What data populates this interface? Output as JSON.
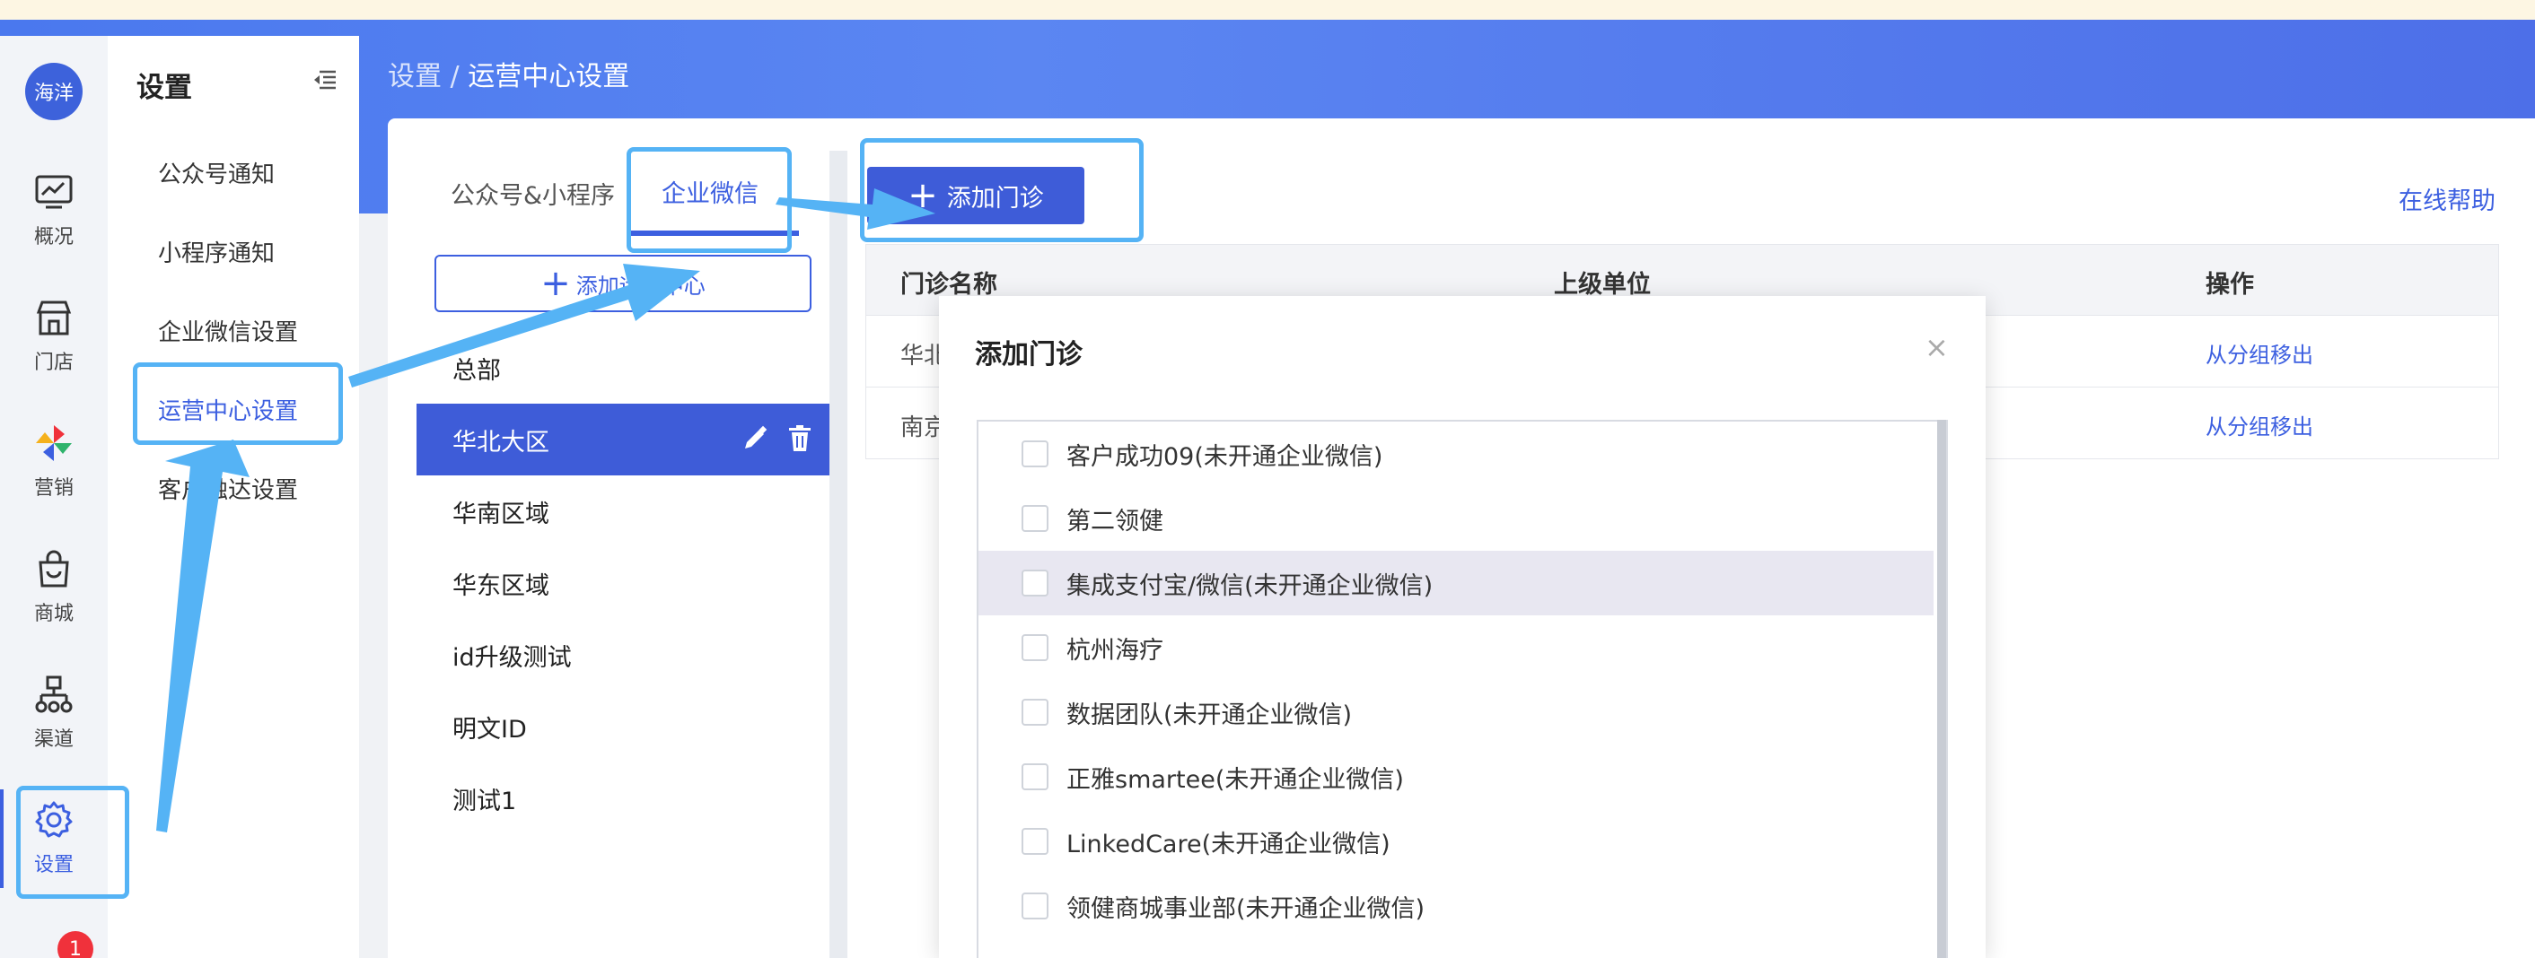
{
  "header": {
    "breadcrumb_parent": "设置 /",
    "breadcrumb_current": "运营中心设置"
  },
  "user": {
    "avatar_text": "海洋"
  },
  "iconnav": {
    "items": [
      {
        "label": "概况",
        "icon": "chart-icon"
      },
      {
        "label": "门店",
        "icon": "store-icon"
      },
      {
        "label": "营销",
        "icon": "pinwheel-icon"
      },
      {
        "label": "商城",
        "icon": "shopping-bag-icon"
      },
      {
        "label": "渠道",
        "icon": "org-tree-icon"
      },
      {
        "label": "设置",
        "icon": "gear-icon"
      }
    ],
    "badge_count": "1"
  },
  "submenu": {
    "title": "设置",
    "items": [
      "公众号通知",
      "小程序通知",
      "企业微信设置",
      "运营中心设置",
      "客户触达设置"
    ]
  },
  "tabs": [
    "公众号&小程序",
    "企业微信"
  ],
  "center_list": {
    "add_button_label": "添加运营中心",
    "items": [
      "总部",
      "华北大区",
      "华南区域",
      "华东区域",
      "id升级测试",
      "明文ID",
      "测试1"
    ],
    "selected": "华北大区"
  },
  "main": {
    "add_clinic_label": "添加门诊",
    "help_link": "在线帮助",
    "table": {
      "columns": [
        "门诊名称",
        "上级单位",
        "操作"
      ],
      "rows": [
        {
          "name": "华北",
          "action": "从分组移出"
        },
        {
          "name": "南京",
          "action": "从分组移出"
        }
      ]
    }
  },
  "modal": {
    "title": "添加门诊",
    "close_glyph": "×",
    "options": [
      "客户成功09(未开通企业微信)",
      "第二领健",
      "集成支付宝/微信(未开通企业微信)",
      "杭州海疗",
      "数据团队(未开通企业微信)",
      "正雅smartee(未开通企业微信)",
      "LinkedCare(未开通企业微信)",
      "领健商城事业部(未开通企业微信)"
    ]
  },
  "colors": {
    "primary": "#3c5fe0",
    "annotation": "#55b3f5",
    "badge": "#f0313b"
  }
}
